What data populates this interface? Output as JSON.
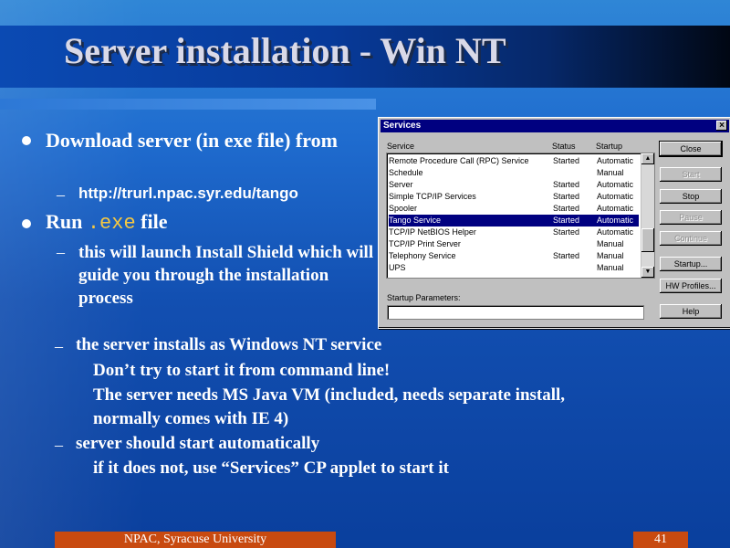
{
  "slide": {
    "title": "Server installation - Win NT",
    "bullets": {
      "download": "Download server (in exe file) from",
      "url": "http://trurl.npac.syr.edu/tango",
      "run_prefix": "Run",
      "run_code": ".exe",
      "run_suffix": "file",
      "install_shield": "this will launch Install Shield which will guide you through the installation process",
      "nt_service": "the server installs as Windows NT service",
      "no_cmdline": "Don’t try to start it from command line!",
      "java_vm": "The server needs MS Java VM (included, needs separate install,",
      "ie4": "normally comes with IE 4)",
      "auto_start": "server should start automatically",
      "services_applet": "if it does not, use “Services” CP applet to start it",
      "dash": "–"
    },
    "footer": {
      "left": "NPAC, Syracuse University",
      "page": "41"
    }
  },
  "services_dialog": {
    "title": "Services",
    "close_glyph": "×",
    "columns": {
      "service": "Service",
      "status": "Status",
      "startup": "Startup"
    },
    "rows": [
      {
        "service": "Remote Procedure Call (RPC) Service",
        "status": "Started",
        "startup": "Automatic"
      },
      {
        "service": "Schedule",
        "status": "",
        "startup": "Manual"
      },
      {
        "service": "Server",
        "status": "Started",
        "startup": "Automatic"
      },
      {
        "service": "Simple TCP/IP Services",
        "status": "Started",
        "startup": "Automatic"
      },
      {
        "service": "Spooler",
        "status": "Started",
        "startup": "Automatic"
      },
      {
        "service": "Tango Service",
        "status": "Started",
        "startup": "Automatic"
      },
      {
        "service": "TCP/IP NetBIOS Helper",
        "status": "Started",
        "startup": "Automatic"
      },
      {
        "service": "TCP/IP Print Server",
        "status": "",
        "startup": "Manual"
      },
      {
        "service": "Telephony Service",
        "status": "Started",
        "startup": "Manual"
      },
      {
        "service": "UPS",
        "status": "",
        "startup": "Manual"
      }
    ],
    "buttons": {
      "close": "Close",
      "start": "Start",
      "stop": "Stop",
      "pause": "Pause",
      "continue": "Continue",
      "startup": "Startup...",
      "hw_profiles": "HW Profiles...",
      "help": "Help"
    },
    "startup_parameters_label": "Startup Parameters:",
    "startup_parameters_value": ""
  }
}
